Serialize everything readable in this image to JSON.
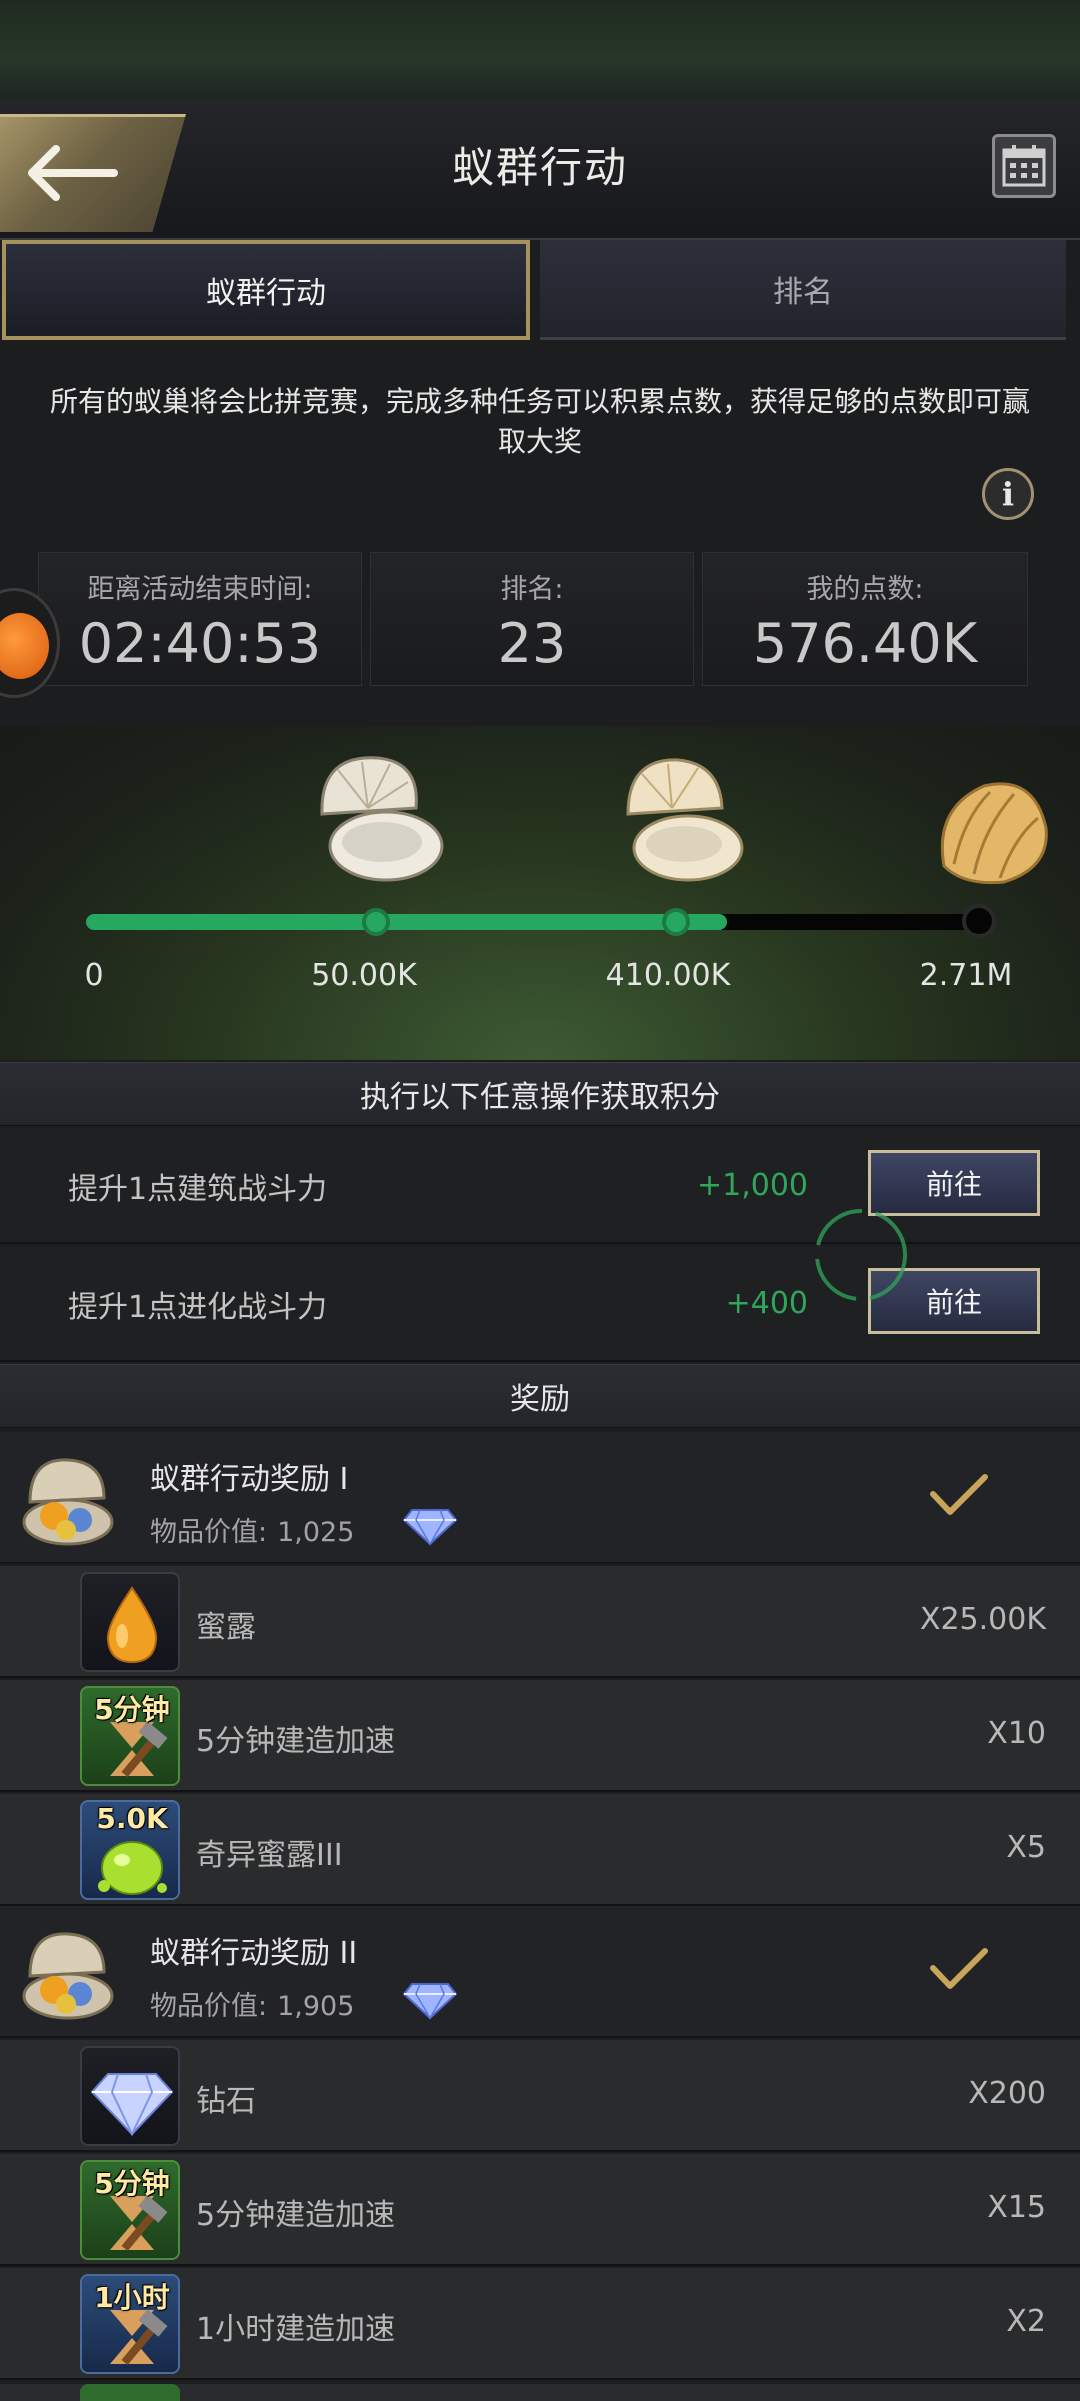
{
  "header": {
    "title": "蚁群行动"
  },
  "tabs": [
    {
      "label": "蚁群行动",
      "active": true
    },
    {
      "label": "排名",
      "active": false
    }
  ],
  "description": "所有的蚁巢将会比拼竞赛，完成多种任务可以积累点数，获得足够的点数即可赢取大奖",
  "stats": [
    {
      "label": "距离活动结束时间:",
      "value": "02:40:53"
    },
    {
      "label": "排名:",
      "value": "23"
    },
    {
      "label": "我的点数:",
      "value": "576.40K"
    }
  ],
  "progress": {
    "fill_fraction": 0.72,
    "milestones": [
      "0",
      "50.00K",
      "410.00K",
      "2.71M"
    ],
    "colors": {
      "filled": "#27a860",
      "empty": "#050505"
    }
  },
  "tasks_header": "执行以下任意操作获取积分",
  "tasks": [
    {
      "name": "提升1点建筑战斗力",
      "points": "+1,000",
      "button": "前往"
    },
    {
      "name": "提升1点进化战斗力",
      "points": "+400",
      "button": "前往"
    }
  ],
  "rewards_header": "奖励",
  "rewards": [
    {
      "title": "蚁群行动奖励 I",
      "value_label": "物品价值:",
      "value": "1,025",
      "items": [
        {
          "icon": "honeydew-drop-icon",
          "tag": "",
          "name": "蜜露",
          "qty": "X25.00K"
        },
        {
          "icon": "hammer-speedup-icon",
          "tag": "5分钟",
          "name": "5分钟建造加速",
          "qty": "X10"
        },
        {
          "icon": "exotic-honeydew-icon",
          "tag": "5.0K",
          "name": "奇异蜜露III",
          "qty": "X5"
        }
      ]
    },
    {
      "title": "蚁群行动奖励 II",
      "value_label": "物品价值:",
      "value": "1,905",
      "items": [
        {
          "icon": "diamond-icon",
          "tag": "",
          "name": "钻石",
          "qty": "X200"
        },
        {
          "icon": "hammer-speedup-icon",
          "tag": "5分钟",
          "name": "5分钟建造加速",
          "qty": "X15"
        },
        {
          "icon": "hammer-speedup-icon",
          "tag": "1小时",
          "name": "1小时建造加速",
          "qty": "X2"
        }
      ]
    }
  ]
}
